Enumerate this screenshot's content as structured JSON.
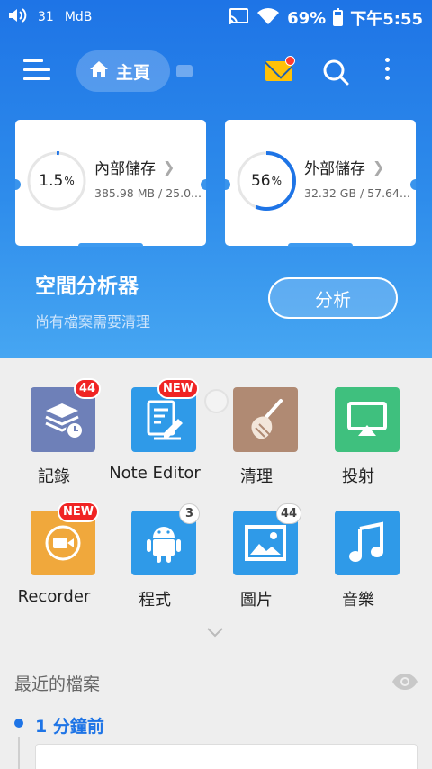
{
  "statusbar": {
    "left_num": "31",
    "left_text": "MdB",
    "battery_pct": "69%",
    "battery_level": 0.69,
    "time": "下午5:55"
  },
  "toolbar": {
    "home_label": "主頁"
  },
  "storage": [
    {
      "percent": "1.5",
      "pct_sign": "%",
      "fill": 0.015,
      "title": "內部儲存",
      "detail": "385.98 MB / 25.0..."
    },
    {
      "percent": "56",
      "pct_sign": "%",
      "fill": 0.56,
      "title": "外部儲存",
      "detail": "32.32 GB / 57.64..."
    }
  ],
  "analyzer": {
    "title": "空間分析器",
    "subtitle": "尚有檔案需要清理",
    "button": "分析"
  },
  "apps": [
    {
      "label": "記錄",
      "badge": "44",
      "icon": "log-icon",
      "color": "#6e80b8"
    },
    {
      "label": "Note Editor",
      "badge": "NEW",
      "icon": "note-editor-icon",
      "color": "#2f9ae8"
    },
    {
      "label": "清理",
      "badge": "",
      "icon": "broom-icon",
      "color": "#b08a73"
    },
    {
      "label": "投射",
      "badge": "",
      "icon": "cast-icon",
      "color": "#3fc07e"
    },
    {
      "label": "Recorder",
      "badge": "NEW",
      "icon": "recorder-icon",
      "color": "#f0a83c"
    },
    {
      "label": "程式",
      "badge": "3",
      "icon": "android-icon",
      "color": "#2f9ae8"
    },
    {
      "label": "圖片",
      "badge": "44",
      "icon": "image-icon",
      "color": "#2f9ae8"
    },
    {
      "label": "音樂",
      "badge": "",
      "icon": "music-icon",
      "color": "#2f9ae8"
    }
  ],
  "recent": {
    "title": "最近的檔案",
    "time_label": "1 分鐘前"
  }
}
